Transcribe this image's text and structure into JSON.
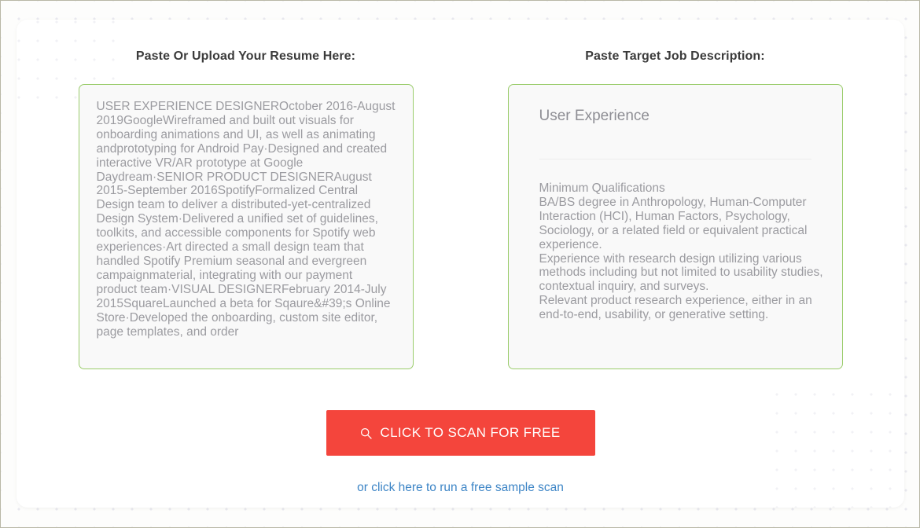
{
  "theme": {
    "accent_green": "#9acc6b",
    "cta_red": "#f4453c",
    "link_blue": "#3d85c6",
    "heading_gray": "#3b3b3b",
    "placeholder_gray": "#9b9ba0"
  },
  "resume_panel": {
    "heading": "Paste Or Upload Your Resume Here:",
    "value": "USER EXPERIENCE DESIGNEROctober 2016-August 2019GoogleWireframed and built out visuals for onboarding animations and UI, as well as animating andprototyping for Android Pay·Designed and created interactive VR/AR prototype at Google Daydream·SENIOR PRODUCT DESIGNERAugust 2015-September 2016SpotifyFormalized Central Design team to deliver a distributed-yet-centralized Design System·Delivered a unified set of guidelines, toolkits, and accessible components for Spotify web experiences·Art directed a small design team that handled Spotify Premium seasonal and evergreen campaignmaterial, integrating with our payment product team·VISUAL DESIGNERFebruary 2014-July 2015SquareLaunched a beta for Sqaure&#39;s Online Store·Developed the onboarding, custom site editor, page templates, and order"
  },
  "job_panel": {
    "heading": "Paste Target Job Description:",
    "title": "User Experience",
    "body": "Minimum Qualifications\nBA/BS degree in Anthropology, Human-Computer Interaction (HCI), Human Factors, Psychology, Sociology, or a related field or equivalent practical experience.\nExperience with research design utilizing various methods including but not limited to usability studies, contextual inquiry, and surveys.\nRelevant product research experience, either in an end-to-end, usability, or generative setting."
  },
  "cta": {
    "button_label": "CLICK TO SCAN FOR FREE",
    "button_icon": "search-icon",
    "link_label": "or click here to run a free sample scan"
  }
}
